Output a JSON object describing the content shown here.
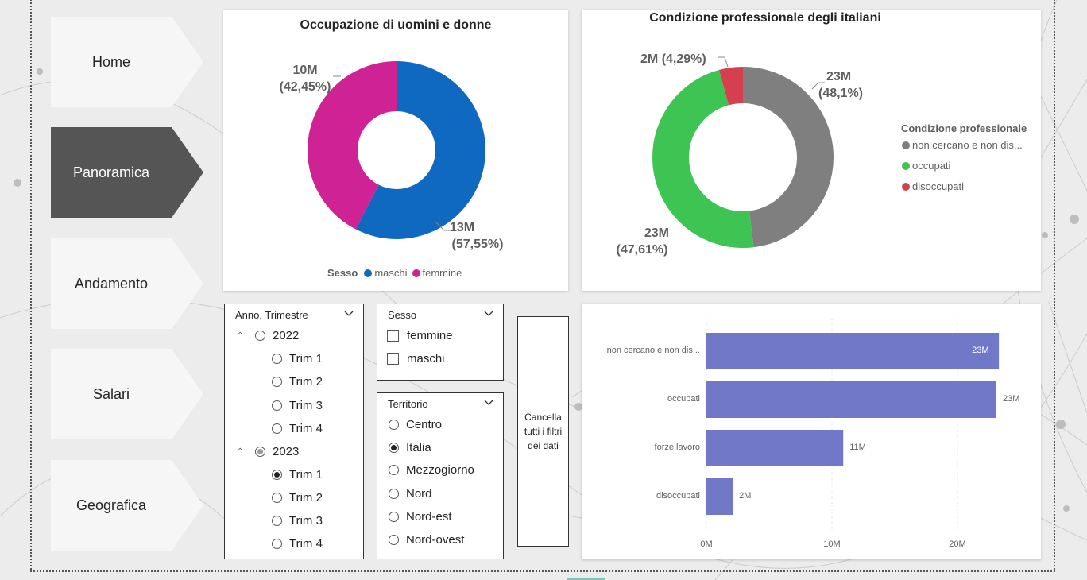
{
  "nav": {
    "items": [
      {
        "label": "Home",
        "active": false
      },
      {
        "label": "Panoramica",
        "active": true
      },
      {
        "label": "Andamento",
        "active": false
      },
      {
        "label": "Salari",
        "active": false
      },
      {
        "label": "Geografica",
        "active": false
      }
    ]
  },
  "gender_chart": {
    "title": "Occupazione di uomini e donne",
    "label_femmine_value": "10M",
    "label_femmine_pct": "(42,45%)",
    "label_maschi_value": "13M",
    "label_maschi_pct": "(57,55%)",
    "legend_title": "Sesso",
    "legend_maschi": "maschi",
    "legend_femmine": "femmine",
    "colors": {
      "maschi": "#1069c1",
      "femmine": "#cf2295"
    }
  },
  "condition_chart": {
    "title": "Condizione professionale degli italiani",
    "label_disoccupati_value": "2M",
    "label_disoccupati_pct": "(4,29%)",
    "label_noncercano_value": "23M",
    "label_noncercano_pct": "(48,1%)",
    "label_occupati_value": "23M",
    "label_occupati_pct": "(47,61%)",
    "legend_title": "Condizione professionale",
    "legend_items": [
      "non cercano e non dis...",
      "occupati",
      "disoccupati"
    ],
    "colors": {
      "non cercano": "#7f7f7f",
      "occupati": "#3ec452",
      "disoccupati": "#d5404f"
    }
  },
  "slicer_anno": {
    "title": "Anno, Trimestre",
    "years": [
      {
        "label": "2022",
        "quarters": [
          "Trim 1",
          "Trim 2",
          "Trim 3",
          "Trim 4"
        ]
      },
      {
        "label": "2023",
        "quarters": [
          "Trim 1",
          "Trim 2",
          "Trim 3",
          "Trim 4"
        ]
      }
    ],
    "selected": "2023 Trim 1"
  },
  "slicer_sesso": {
    "title": "Sesso",
    "options": [
      "femmine",
      "maschi"
    ]
  },
  "slicer_territorio": {
    "title": "Territorio",
    "options": [
      "Centro",
      "Italia",
      "Mezzogiorno",
      "Nord",
      "Nord-est",
      "Nord-ovest"
    ],
    "selected": "Italia"
  },
  "clear_button": {
    "label": "Cancella tutti i filtri dei dati"
  },
  "chart_data": {
    "type": "bar",
    "orientation": "horizontal",
    "categories": [
      "non cercano e non dis...",
      "occupati",
      "forze lavoro",
      "disoccupati"
    ],
    "values": [
      23.3,
      23.1,
      10.9,
      2.1
    ],
    "data_labels": [
      "23M",
      "23M",
      "11M",
      "2M"
    ],
    "xticks": [
      "0M",
      "10M",
      "20M"
    ],
    "xlim": [
      0,
      24
    ],
    "unit": "M",
    "bar_color": "#7178c7",
    "grid": true
  }
}
